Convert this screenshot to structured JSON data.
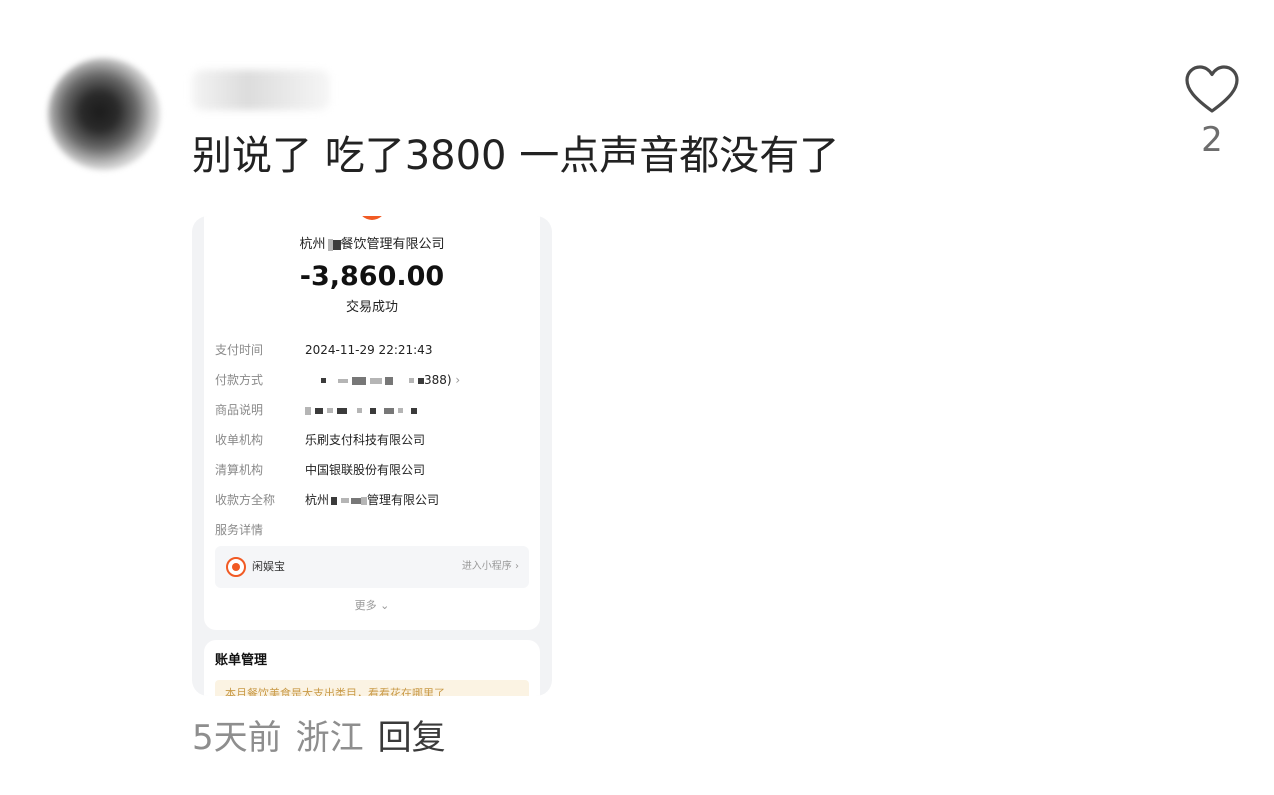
{
  "comment": {
    "username": "",
    "text": "别说了 吃了3800 一点声音都没有了",
    "likes": "2",
    "time": "5天前",
    "location": "浙江",
    "reply_label": "回复"
  },
  "receipt": {
    "merchant": "杭州 餐饮管理有限公司",
    "merchant_prefix": "杭州",
    "merchant_suffix": "餐饮管理有限公司",
    "amount": "-3,860.00",
    "status": "交易成功",
    "rows": [
      {
        "label": "支付时间",
        "value": "2024-11-29 22:21:43"
      },
      {
        "label": "付款方式",
        "value": "388)"
      },
      {
        "label": "商品说明",
        "value": ""
      },
      {
        "label": "收单机构",
        "value": "乐刷支付科技有限公司"
      },
      {
        "label": "清算机构",
        "value": "中国银联股份有限公司"
      },
      {
        "label": "收款方全称",
        "value_prefix": "杭州",
        "value_suffix": "管理有限公司"
      },
      {
        "label": "服务详情",
        "value": ""
      }
    ],
    "service": {
      "name": "闲娱宝",
      "link": "进入小程序"
    },
    "more": "更多",
    "bill_title": "账单管理",
    "banner_text": "本月餐饮美食是大支出类目，看看花在哪里了"
  },
  "icons": {
    "like": "heart-outline-icon",
    "service": "xianyubao-logo-icon"
  }
}
